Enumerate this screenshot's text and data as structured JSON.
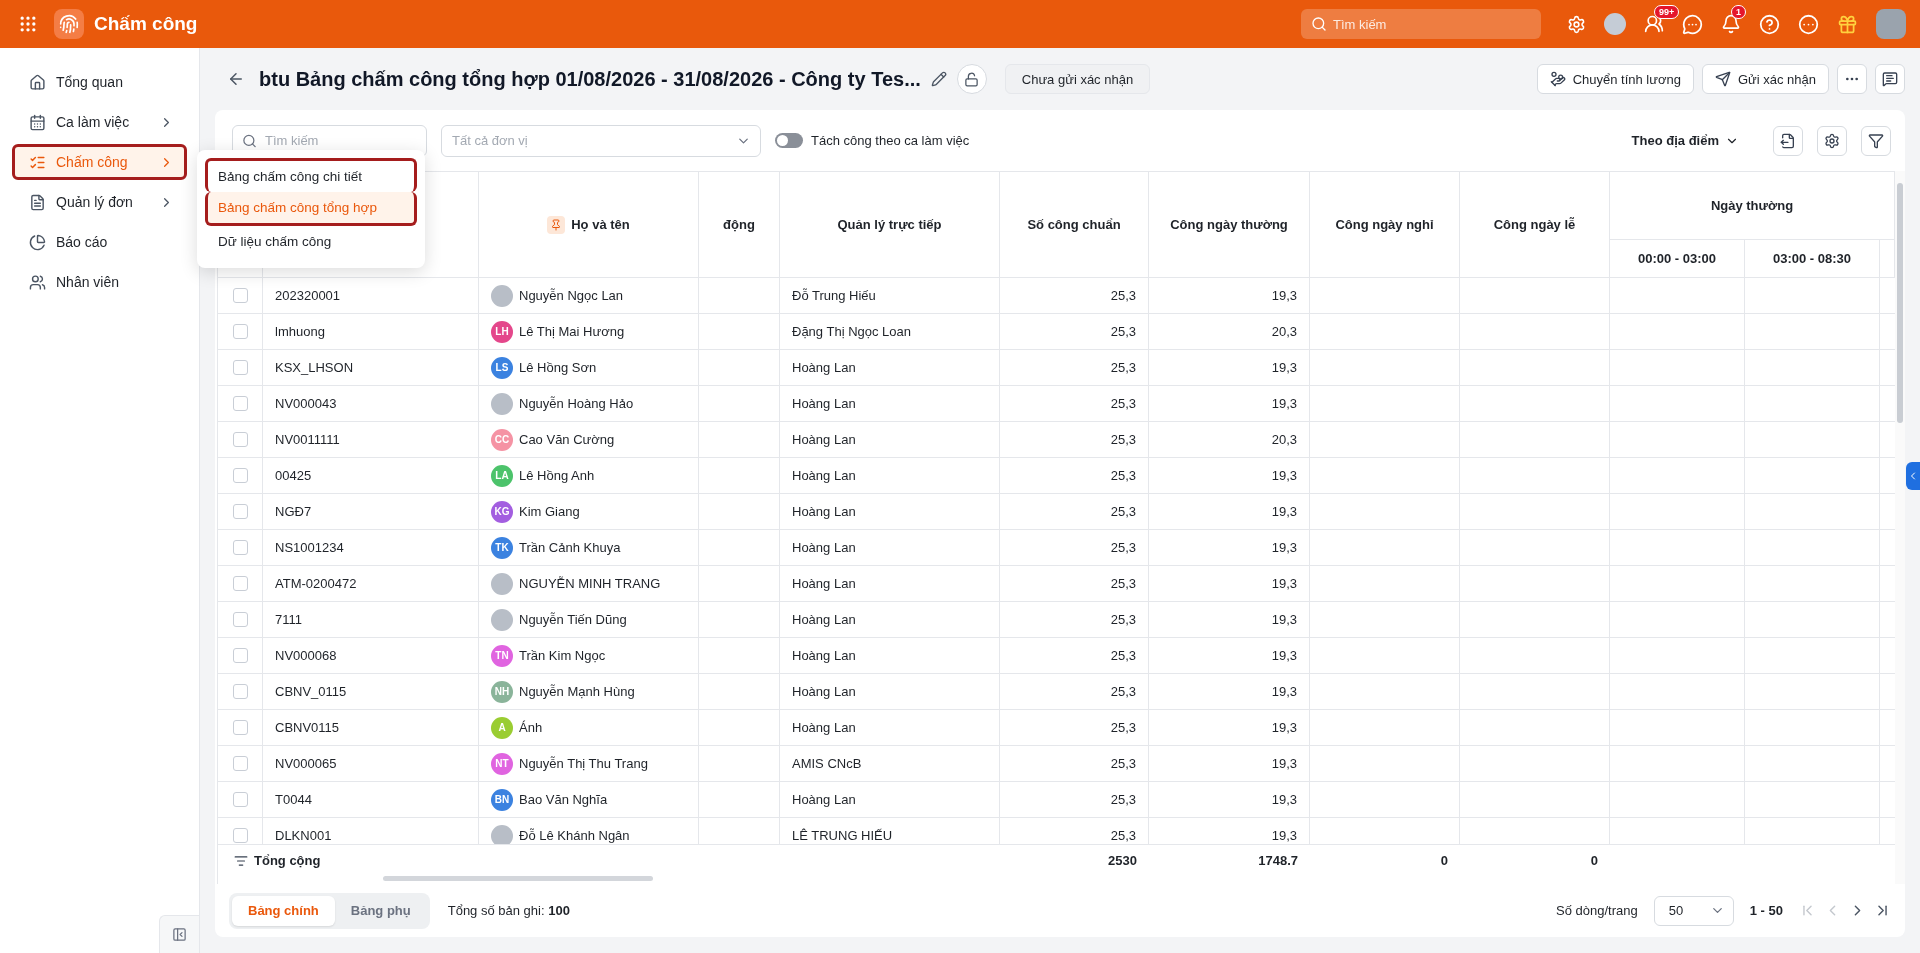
{
  "topbar": {
    "title": "Chấm công",
    "search": {
      "placeholder": "Tìm kiếm"
    },
    "icons": [
      {
        "kind": "settings"
      },
      {
        "kind": "avatar"
      },
      {
        "kind": "team",
        "badge": "99+"
      },
      {
        "kind": "chat"
      },
      {
        "kind": "bell",
        "badge": "1"
      },
      {
        "kind": "help"
      },
      {
        "kind": "more"
      },
      {
        "kind": "gift"
      },
      {
        "kind": "user"
      }
    ]
  },
  "sidebar": {
    "items": [
      {
        "label": "Tổng quan",
        "kind": "home",
        "has_children": false,
        "selected": false,
        "highlighted": false
      },
      {
        "label": "Ca làm việc",
        "kind": "calendar",
        "has_children": true,
        "selected": false,
        "highlighted": false
      },
      {
        "label": "Chấm công",
        "kind": "checklist",
        "has_children": true,
        "selected": true,
        "highlighted": true
      },
      {
        "label": "Quản lý đơn",
        "kind": "document",
        "has_children": true,
        "selected": false,
        "highlighted": false
      },
      {
        "label": "Báo cáo",
        "kind": "chart",
        "has_children": false,
        "selected": false,
        "highlighted": false
      },
      {
        "label": "Nhân viên",
        "kind": "users",
        "has_children": false,
        "selected": false,
        "highlighted": false
      }
    ]
  },
  "submenu": {
    "items": [
      {
        "label": "Bảng chấm công chi tiết",
        "selected": false,
        "highlighted": true
      },
      {
        "label": "Bảng chấm công tổng hợp",
        "selected": true,
        "highlighted": true
      },
      {
        "label": "Dữ liệu chấm công",
        "selected": false,
        "highlighted": false
      }
    ]
  },
  "header": {
    "title": "btu Bảng chấm công tổng hợp 01/08/2026 - 31/08/2026 - Công ty Tes...",
    "status": "Chưa gửi xác nhận",
    "actions": [
      {
        "kind": "payroll",
        "label": "Chuyển tính lương"
      },
      {
        "kind": "send",
        "label": "Gửi xác nhận"
      }
    ]
  },
  "toolbar": {
    "search": {
      "placeholder": "Tìm kiếm"
    },
    "unit_select": {
      "placeholder": "Tất cả đơn vị"
    },
    "toggle": {
      "label": "Tách công theo ca làm việc",
      "on": false
    },
    "group_by": "Theo địa điểm"
  },
  "table": {
    "columns": [
      {
        "label": "Họ và tên",
        "pinned": true
      },
      {
        "label": "động",
        "pinned": false
      },
      {
        "label": "Quản lý trực tiếp",
        "pinned": false
      },
      {
        "label": "Số công chuẩn",
        "pinned": false
      },
      {
        "label": "Công ngày thường",
        "pinned": false
      },
      {
        "label": "Công ngày nghỉ",
        "pinned": false
      },
      {
        "label": "Công ngày lễ",
        "pinned": false
      }
    ],
    "column_group": {
      "label": "Ngày thường",
      "columns": [
        "00:00 - 03:00",
        "03:00 - 08:30"
      ]
    },
    "rows": [
      {
        "checked": false,
        "code": "202320001",
        "name": "Nguyễn Ngọc Lan",
        "avatar": {
          "kind": "photo"
        },
        "manager": "Đỗ Trung Hiếu",
        "standard": "25,3",
        "normal": "19,3"
      },
      {
        "checked": false,
        "code": "lmhuong",
        "name": "Lê Thị Mai Hương",
        "avatar": {
          "kind": "initials",
          "text": "LH",
          "color": "#e4478b"
        },
        "manager": "Đặng Thị Ngọc Loan",
        "standard": "25,3",
        "normal": "20,3"
      },
      {
        "checked": false,
        "code": "KSX_LHSON",
        "name": "Lê Hồng Sơn",
        "avatar": {
          "kind": "initials",
          "text": "LS",
          "color": "#3b82e0"
        },
        "manager": "Hoàng Lan",
        "standard": "25,3",
        "normal": "19,3"
      },
      {
        "checked": false,
        "code": "NV000043",
        "name": "Nguyễn Hoàng Hảo",
        "avatar": {
          "kind": "photo"
        },
        "manager": "Hoàng Lan",
        "standard": "25,3",
        "normal": "19,3"
      },
      {
        "checked": false,
        "code": "NV0011111",
        "name": "Cao Văn Cường",
        "avatar": {
          "kind": "initials",
          "text": "CC",
          "color": "#f593a4"
        },
        "manager": "Hoàng Lan",
        "standard": "25,3",
        "normal": "20,3"
      },
      {
        "checked": false,
        "code": "00425",
        "name": "Lê Hồng Anh",
        "avatar": {
          "kind": "initials",
          "text": "LA",
          "color": "#4cc36b"
        },
        "manager": "Hoàng Lan",
        "standard": "25,3",
        "normal": "19,3"
      },
      {
        "checked": false,
        "code": "NGĐ7",
        "name": "Kim Giang",
        "avatar": {
          "kind": "initials",
          "text": "KG",
          "color": "#a35ee0"
        },
        "manager": "Hoàng Lan",
        "standard": "25,3",
        "normal": "19,3"
      },
      {
        "checked": false,
        "code": "NS1001234",
        "name": "Trần Cảnh Khuya",
        "avatar": {
          "kind": "initials",
          "text": "TK",
          "color": "#3b82e0"
        },
        "manager": "Hoàng Lan",
        "standard": "25,3",
        "normal": "19,3"
      },
      {
        "checked": false,
        "code": "ATM-0200472",
        "name": "NGUYỄN MINH TRANG",
        "avatar": {
          "kind": "photo"
        },
        "manager": "Hoàng Lan",
        "standard": "25,3",
        "normal": "19,3"
      },
      {
        "checked": false,
        "code": "7111",
        "name": "Nguyễn Tiến Dũng",
        "avatar": {
          "kind": "photo"
        },
        "manager": "Hoàng Lan",
        "standard": "25,3",
        "normal": "19,3"
      },
      {
        "checked": false,
        "code": "NV000068",
        "name": "Trần Kim Ngọc",
        "avatar": {
          "kind": "initials",
          "text": "TN",
          "color": "#e064e0"
        },
        "manager": "Hoàng Lan",
        "standard": "25,3",
        "normal": "19,3"
      },
      {
        "checked": false,
        "code": "CBNV_0115",
        "name": "Nguyễn Mạnh Hùng",
        "avatar": {
          "kind": "initials",
          "text": "NH",
          "color": "#8ab49a"
        },
        "manager": "Hoàng Lan",
        "standard": "25,3",
        "normal": "19,3"
      },
      {
        "checked": false,
        "code": "CBNV0115",
        "name": "Ánh",
        "avatar": {
          "kind": "initials",
          "text": "A",
          "color": "#9acd32"
        },
        "manager": "Hoàng Lan",
        "standard": "25,3",
        "normal": "19,3"
      },
      {
        "checked": false,
        "code": "NV000065",
        "name": "Nguyễn Thị Thu Trang",
        "avatar": {
          "kind": "initials",
          "text": "NT",
          "color": "#e064e0"
        },
        "manager": "AMIS CNcB",
        "standard": "25,3",
        "normal": "19,3"
      },
      {
        "checked": false,
        "code": "T0044",
        "name": "Bao Văn Nghĩa",
        "avatar": {
          "kind": "initials",
          "text": "BN",
          "color": "#3b82e0"
        },
        "manager": "Hoàng Lan",
        "standard": "25,3",
        "normal": "19,3"
      },
      {
        "checked": false,
        "code": "DLKN001",
        "name": "Đỗ Lê Khánh Ngân",
        "avatar": {
          "kind": "photo"
        },
        "manager": "LÊ TRUNG HIẾU",
        "standard": "25,3",
        "normal": "19,3"
      }
    ],
    "totals": {
      "label": "Tổng cộng",
      "values": [
        "2530",
        "1748.7",
        "0",
        "0"
      ]
    }
  },
  "footer": {
    "tabs": [
      {
        "label": "Bảng chính",
        "selected": true
      },
      {
        "label": "Bảng phụ",
        "selected": false
      }
    ],
    "record_count": "Tổng số bản ghi: **100**",
    "page_size_label": "Số dòng/trang",
    "page_size": "50",
    "range": "1 - 50",
    "pager": [
      {
        "kind": "first",
        "disabled": true
      },
      {
        "kind": "prev",
        "disabled": true
      },
      {
        "kind": "next",
        "disabled": false
      },
      {
        "kind": "last",
        "disabled": false
      }
    ]
  }
}
